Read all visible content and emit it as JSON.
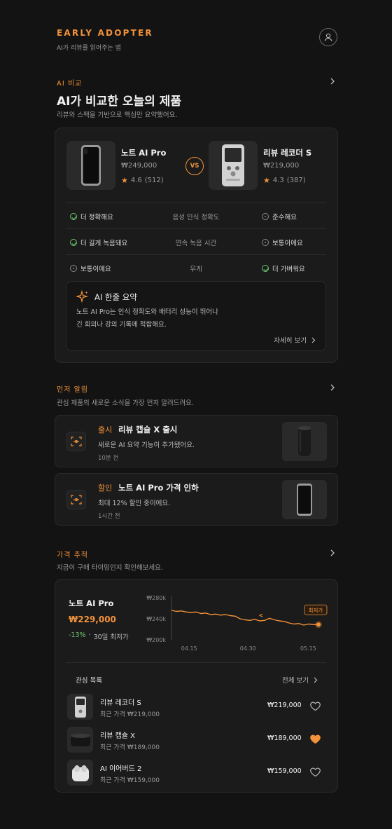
{
  "header": {
    "brand": "EARLY ADOPTER",
    "tagline": "AI가 리뷰를 읽어주는 앱"
  },
  "compare": {
    "label": "AI 비교",
    "title": "AI가 비교한 오늘의 제품",
    "subtitle": "리뷰와 스펙을 기반으로 핵심만 요약했어요.",
    "vs": "VS",
    "left": {
      "name": "노트 AI Pro",
      "price": "₩249,000",
      "rating": "4.6",
      "reviews": "(512)"
    },
    "right": {
      "name": "리뷰 레코더 S",
      "price": "₩219,000",
      "rating": "4.3",
      "reviews": "(387)"
    },
    "rows": [
      {
        "left": "더 정확해요",
        "left_icon": "check-icon",
        "metric": "음성 인식 정확도",
        "right": "준수해요",
        "right_icon": "neutral-icon"
      },
      {
        "left": "더 길게 녹음돼요",
        "left_icon": "check-icon",
        "metric": "연속 녹음 시간",
        "right": "보통이에요",
        "right_icon": "neutral-icon"
      },
      {
        "left": "보통이에요",
        "left_icon": "neutral-icon",
        "metric": "무게",
        "right": "더 가벼워요",
        "right_icon": "check-icon"
      }
    ],
    "summary": {
      "title": "AI 한줄 요약",
      "line1": "노트 AI Pro는 인식 정확도와 배터리 성능이 뛰어나",
      "line2": "긴 회의나 강의 기록에 적합해요.",
      "more": "자세히 보기"
    }
  },
  "alerts": {
    "label": "먼저 알림",
    "subtitle": "관심 제품의 새로운 소식을 가장 먼저 알려드려요.",
    "items": [
      {
        "tag": "출시",
        "title": "리뷰 캡슐 X 출시",
        "desc": "새로운 AI 요약 기능이 추가됐어요.",
        "time": "10분 전"
      },
      {
        "tag": "할인",
        "title": "노트 AI Pro 가격 인하",
        "desc": "최대 12% 할인 중이에요.",
        "time": "1시간 전"
      }
    ]
  },
  "tracking": {
    "label": "가격 추적",
    "subtitle": "지금이 구매 타이밍인지 확인해보세요.",
    "product": "노트 AI Pro",
    "price": "₩229,000",
    "change": "-13%",
    "sep": "·",
    "low_note": "30일 최저가",
    "chart_data": {
      "type": "line",
      "y_ticks": [
        "₩280k",
        "₩240k",
        "₩200k"
      ],
      "x_ticks": [
        "04.15",
        "04.30",
        "05.15"
      ],
      "ylim": [
        200000,
        280000
      ],
      "x": [
        0,
        1,
        2,
        3,
        4,
        5,
        6,
        7,
        8,
        9,
        10,
        11,
        12,
        13,
        14,
        15,
        16,
        17,
        18,
        19,
        20,
        21,
        22,
        23,
        24,
        25,
        26,
        27,
        28,
        29,
        30
      ],
      "values": [
        256000,
        254000,
        255000,
        253000,
        252000,
        253000,
        250000,
        251000,
        248000,
        249000,
        247000,
        248000,
        246000,
        245000,
        240000,
        238000,
        237000,
        239000,
        236000,
        237000,
        241000,
        238000,
        236000,
        235000,
        232000,
        230000,
        231000,
        228000,
        230000,
        229000,
        229000
      ],
      "annotation": "최저가"
    },
    "watchlist": {
      "title": "관심 목록",
      "more": "전체 보기",
      "items": [
        {
          "name": "리뷰 레코더 S",
          "recent": "최근 가격 ₩219,000",
          "price": "₩219,000",
          "liked": false
        },
        {
          "name": "리뷰 캡슐 X",
          "recent": "최근 가격 ₩189,000",
          "price": "₩189,000",
          "liked": true
        },
        {
          "name": "AI 이어버드 2",
          "recent": "최근 가격 ₩159,000",
          "price": "₩159,000",
          "liked": false
        }
      ]
    }
  },
  "colors": {
    "accent": "#f2923a",
    "positive": "#6cc36c",
    "background": "#131313",
    "card": "#1b1b1b"
  }
}
